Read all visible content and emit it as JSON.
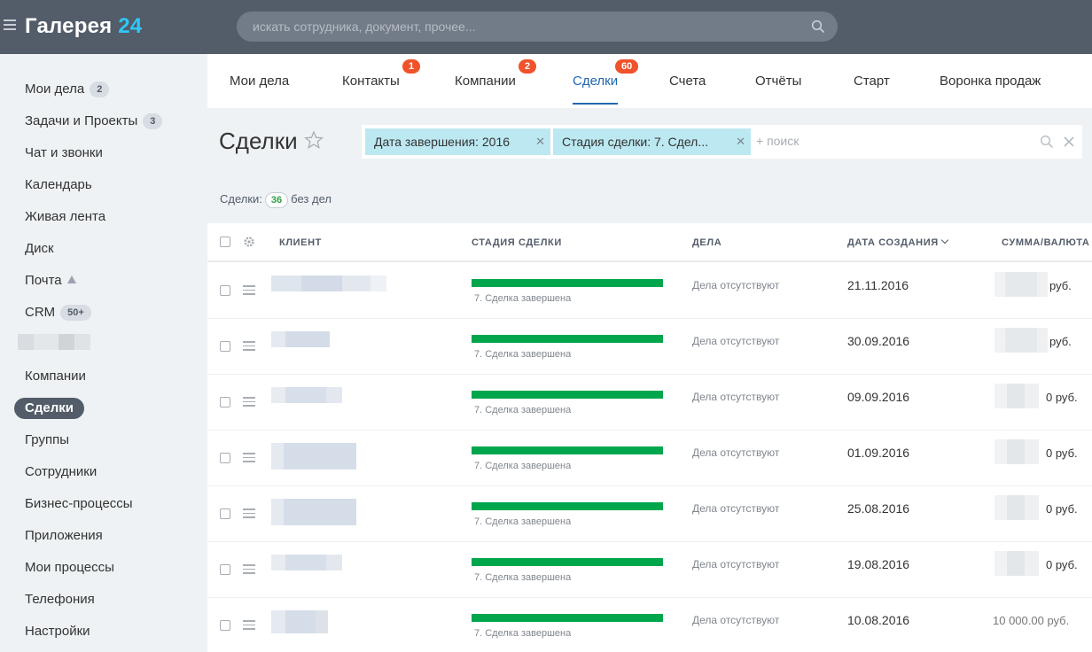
{
  "app": {
    "logo_main": "Галерея",
    "logo_num": "24"
  },
  "search": {
    "placeholder": "искать сотрудника, документ, прочее..."
  },
  "sidebar": {
    "items": [
      {
        "label": "Мои дела",
        "count": "2"
      },
      {
        "label": "Задачи и Проекты",
        "count": "3"
      },
      {
        "label": "Чат и звонки"
      },
      {
        "label": "Календарь"
      },
      {
        "label": "Живая лента"
      },
      {
        "label": "Диск"
      },
      {
        "label": "Почта"
      },
      {
        "label": "CRM",
        "count": "50+"
      },
      {
        "label": "Компании"
      },
      {
        "label": "Сделки"
      },
      {
        "label": "Группы"
      },
      {
        "label": "Сотрудники"
      },
      {
        "label": "Бизнес-процессы"
      },
      {
        "label": "Приложения"
      },
      {
        "label": "Мои процессы"
      },
      {
        "label": "Телефония"
      },
      {
        "label": "Настройки"
      }
    ]
  },
  "tabs": [
    {
      "label": "Мои дела"
    },
    {
      "label": "Контакты",
      "badge": "1"
    },
    {
      "label": "Компании",
      "badge": "2"
    },
    {
      "label": "Сделки",
      "badge": "60"
    },
    {
      "label": "Счета"
    },
    {
      "label": "Отчёты"
    },
    {
      "label": "Старт"
    },
    {
      "label": "Воронка продаж"
    }
  ],
  "page": {
    "title": "Сделки"
  },
  "filter": {
    "chips": [
      {
        "label": "Дата завершения: 2016"
      },
      {
        "label": "Стадия сделки: 7. Сдел..."
      }
    ],
    "input_placeholder": "+ поиск"
  },
  "counter": {
    "prefix": "Сделки:",
    "count": "36",
    "suffix": "без дел"
  },
  "grid": {
    "headers": {
      "client": "КЛИЕНТ",
      "stage": "СТАДИЯ СДЕЛКИ",
      "deals": "ДЕЛА",
      "created": "ДАТА СОЗДАНИЯ",
      "sum": "СУММА/ВАЛЮТА"
    },
    "rows": [
      {
        "stage": "7. Сделка завершена",
        "deals": "Дела отсутствуют",
        "date": "21.11.2016",
        "sum": "руб."
      },
      {
        "stage": "7. Сделка завершена",
        "deals": "Дела отсутствуют",
        "date": "30.09.2016",
        "sum": "руб."
      },
      {
        "stage": "7. Сделка завершена",
        "deals": "Дела отсутствуют",
        "date": "09.09.2016",
        "sum": "0 руб."
      },
      {
        "stage": "7. Сделка завершена",
        "deals": "Дела отсутствуют",
        "date": "01.09.2016",
        "sum": "0 руб."
      },
      {
        "stage": "7. Сделка завершена",
        "deals": "Дела отсутствуют",
        "date": "25.08.2016",
        "sum": "0 руб."
      },
      {
        "stage": "7. Сделка завершена",
        "deals": "Дела отсутствуют",
        "date": "19.08.2016",
        "sum": "0 руб."
      },
      {
        "stage": "7. Сделка завершена",
        "deals": "Дела отсутствуют",
        "date": "10.08.2016",
        "sum": "10 000.00 руб."
      }
    ]
  },
  "colors": {
    "topbar": "#535c69",
    "accent": "#2fc7f7",
    "active_tab": "#2067b0",
    "badge": "#f0522b",
    "stage_bar": "#00a64c",
    "chip": "#bce8f1"
  }
}
